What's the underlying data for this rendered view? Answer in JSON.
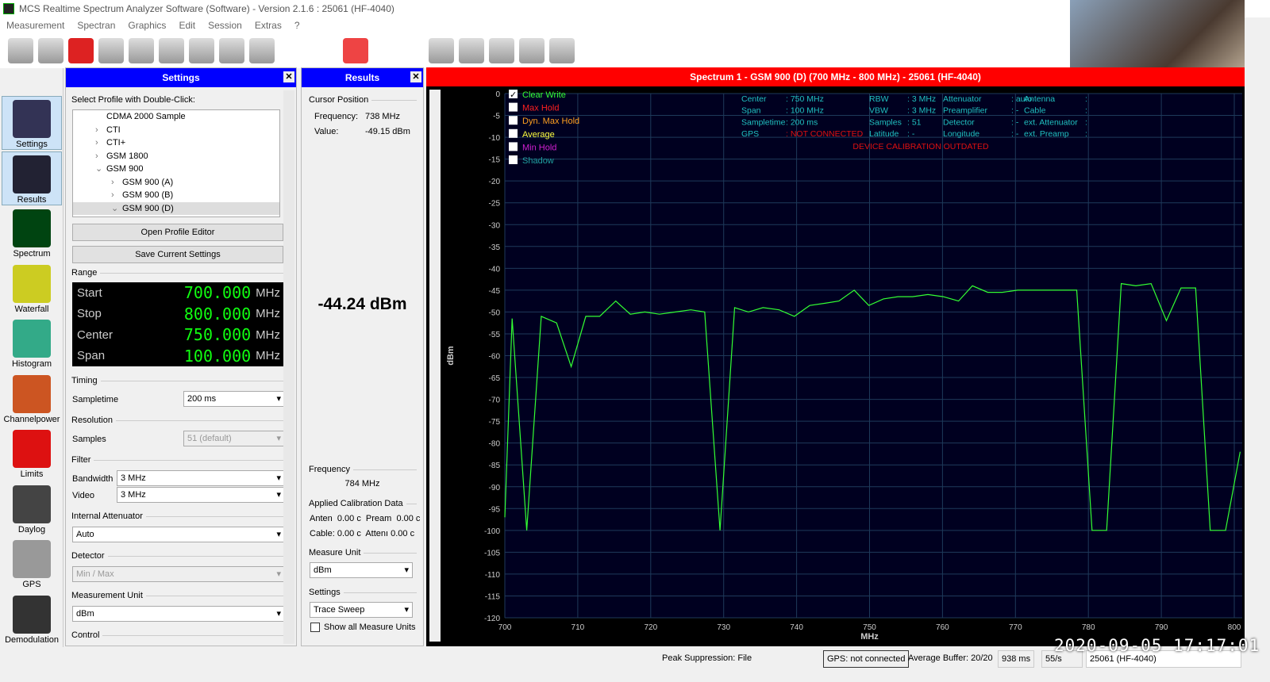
{
  "window": {
    "title": "MCS Realtime Spectrum Analyzer Software (Software) - Version 2.1.6 : 25061 (HF-4040)"
  },
  "menu": [
    "Measurement",
    "Spectran",
    "Graphics",
    "Edit",
    "Session",
    "Extras",
    "?"
  ],
  "nav": [
    {
      "label": "Settings"
    },
    {
      "label": "Results"
    },
    {
      "label": "Spectrum"
    },
    {
      "label": "Waterfall"
    },
    {
      "label": "Histogram"
    },
    {
      "label": "Channelpower"
    },
    {
      "label": "Limits"
    },
    {
      "label": "Daylog"
    },
    {
      "label": "GPS"
    },
    {
      "label": "Demodulation"
    }
  ],
  "settings": {
    "title": "Settings",
    "profile_label": "Select Profile with Double-Click:",
    "tree": [
      {
        "label": "CDMA 2000 Sample",
        "indent": 1,
        "exp": ""
      },
      {
        "label": "CTI",
        "indent": 1,
        "exp": ">"
      },
      {
        "label": "CTI+",
        "indent": 1,
        "exp": ">"
      },
      {
        "label": "GSM 1800",
        "indent": 1,
        "exp": ">"
      },
      {
        "label": "GSM 900",
        "indent": 1,
        "exp": "v"
      },
      {
        "label": "GSM 900 (A)",
        "indent": 2,
        "exp": ">"
      },
      {
        "label": "GSM 900 (B)",
        "indent": 2,
        "exp": ">"
      },
      {
        "label": "GSM 900 (D)",
        "indent": 2,
        "exp": "v"
      }
    ],
    "open_editor": "Open Profile Editor",
    "save_settings": "Save Current Settings",
    "range_label": "Range",
    "range": [
      {
        "name": "Start",
        "value": "700.000",
        "unit": "MHz"
      },
      {
        "name": "Stop",
        "value": "800.000",
        "unit": "MHz"
      },
      {
        "name": "Center",
        "value": "750.000",
        "unit": "MHz"
      },
      {
        "name": "Span",
        "value": "100.000",
        "unit": "MHz"
      }
    ],
    "timing_label": "Timing",
    "sampletime_label": "Sampletime",
    "sampletime": "200 ms",
    "resolution_label": "Resolution",
    "samples_label": "Samples",
    "samples": "51 (default)",
    "filter_label": "Filter",
    "bandwidth_label": "Bandwidth",
    "bandwidth": "3 MHz",
    "video_label": "Video",
    "video": "3 MHz",
    "attenuator_label": "Internal Attenuator",
    "attenuator": "Auto",
    "detector_label": "Detector",
    "detector": "Min / Max",
    "unit_label": "Measurement Unit",
    "unit": "dBm",
    "control_label": "Control"
  },
  "results": {
    "title": "Results",
    "cursor_label": "Cursor Position",
    "freq_label": "Frequency:",
    "freq": "738 MHz",
    "value_label": "Value:",
    "value": "-49.15 dBm",
    "big_value": "-44.24 dBm",
    "frequency_label": "Frequency",
    "frequency": "784 MHz",
    "cal_label": "Applied Calibration Data",
    "cal_row1": "Anten  0.00 c  Pream  0.00 c",
    "cal_row2": "Cable: 0.00 c  Attenı 0.00 c",
    "measure_unit_label": "Measure Unit",
    "measure_unit": "dBm",
    "settings_label": "Settings",
    "settings_value": "Trace Sweep",
    "show_all": "Show all Measure Units"
  },
  "chart_header": "Spectrum 1 - GSM 900 (D) (700 MHz - 800 MHz) - 25061 (HF-4040)",
  "legend": [
    {
      "label": "Clear Write",
      "checked": true,
      "color": "#33ff33"
    },
    {
      "label": "Max Hold",
      "checked": false,
      "color": "#ff2020"
    },
    {
      "label": "Dyn. Max Hold",
      "checked": false,
      "color": "#ffa020"
    },
    {
      "label": "Average",
      "checked": false,
      "color": "#ffff40"
    },
    {
      "label": "Min Hold",
      "checked": false,
      "color": "#d020d0"
    },
    {
      "label": "Shadow",
      "checked": false,
      "color": "#20a0a0"
    }
  ],
  "info": {
    "col1": [
      "Center",
      ": 750 MHz",
      "Span",
      ": 100 MHz",
      "Sampletime",
      ": 200 ms",
      "GPS",
      ": NOT CONNECTED"
    ],
    "col2": [
      "RBW",
      ": 3 MHz",
      "VBW",
      ": 3 MHz",
      "Samples",
      ": 51",
      "Latitude",
      ": -"
    ],
    "col3": [
      "Attenuator",
      ": auto",
      "Preamplifier",
      ": -",
      "Detector",
      ": -",
      "Longitude",
      ": -"
    ],
    "col4": [
      "Antenna",
      ":",
      "Cable",
      ":",
      "ext. Attenuator",
      ":",
      "ext. Preamp",
      ":"
    ],
    "warning": "DEVICE CALIBRATION OUTDATED"
  },
  "chart_data": {
    "type": "line",
    "xlabel": "MHz",
    "ylabel": "dBm",
    "xlim": [
      700,
      800
    ],
    "ylim": [
      -120,
      0
    ],
    "xticks": [
      700,
      710,
      720,
      730,
      740,
      750,
      760,
      770,
      780,
      790,
      800
    ],
    "yticks": [
      0,
      -5,
      -10,
      -15,
      -20,
      -25,
      -30,
      -35,
      -40,
      -45,
      -50,
      -55,
      -60,
      -65,
      -70,
      -75,
      -80,
      -85,
      -90,
      -95,
      -100,
      -105,
      -110,
      -115,
      -120
    ],
    "grid": true,
    "background": "#000020",
    "grid_color": "#1e3a5a",
    "series": [
      {
        "name": "Clear Write",
        "color": "#33ff33",
        "x": [
          700,
          701,
          703,
          705,
          707.1,
          709.1,
          711.1,
          713,
          715.2,
          717.2,
          719.2,
          721.2,
          723.4,
          725.5,
          727.4,
          729.5,
          731.5,
          733.4,
          735.4,
          737.6,
          739.7,
          741.8,
          743.9,
          745.8,
          747.9,
          749.9,
          751.9,
          753.9,
          755.9,
          758,
          760.1,
          762.2,
          764.1,
          766.2,
          768.2,
          770.3,
          772.3,
          774.3,
          776.3,
          778.4,
          780.5,
          782.5,
          784.5,
          786.5,
          788.6,
          790.7,
          792.7,
          794.7,
          796.7,
          798.8,
          800.8
        ],
        "y": [
          -97,
          -51.5,
          -100,
          -51,
          -52.5,
          -62.5,
          -51,
          -51,
          -47.5,
          -50.5,
          -50,
          -50.5,
          -50,
          -49.5,
          -50,
          -100,
          -49,
          -50,
          -49,
          -49.5,
          -51,
          -48.5,
          -48,
          -47.5,
          -45,
          -48.5,
          -47,
          -46.5,
          -46.5,
          -46,
          -46.5,
          -47.5,
          -44,
          -45.5,
          -45.5,
          -45,
          -45,
          -45,
          -45,
          -45,
          -100,
          -100,
          -43.5,
          -44,
          -43.5,
          -52,
          -44.5,
          -44.5,
          -100,
          -100,
          -82
        ]
      }
    ]
  },
  "status": {
    "peak": "Peak Suppression: File",
    "gps": "GPS: not connected",
    "buffer": "Average Buffer: 20/20",
    "ms": "938 ms",
    "rate": "55/s",
    "device": "25061 (HF-4040)"
  },
  "overlay": {
    "timestamp": "2020-09-05  17:17:01"
  }
}
